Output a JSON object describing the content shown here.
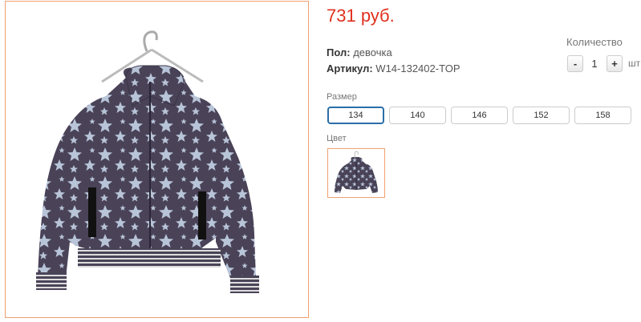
{
  "product": {
    "price": "731 руб.",
    "gender_label": "Пол:",
    "gender_value": "девочка",
    "sku_label": "Артикул:",
    "sku_value": "W14-132402-TOP"
  },
  "quantity": {
    "label": "Количество",
    "minus": "-",
    "value": "1",
    "plus": "+",
    "unit": "шт"
  },
  "sizes": {
    "label": "Размер",
    "options": [
      "134",
      "140",
      "146",
      "152",
      "158"
    ],
    "selected": "134"
  },
  "color": {
    "label": "Цвет"
  },
  "colors": {
    "jacket_body": "#4a4358",
    "star": "#b8c4d8",
    "price": "#e0301e",
    "frame_accent": "#f0a070",
    "selected_border": "#2a6ea8"
  }
}
